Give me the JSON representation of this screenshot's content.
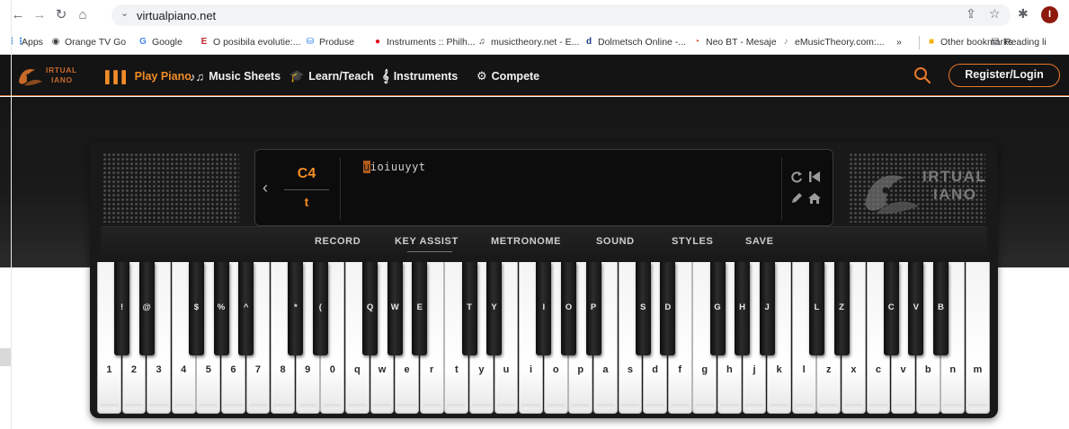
{
  "browser": {
    "url": "virtualpiano.net",
    "profile_initial": "I",
    "bookmarks": [
      {
        "label": "Apps",
        "icon": "apps-grid-icon",
        "color": "#1a73e8",
        "glyph": "⋮⋮"
      },
      {
        "label": "Orange TV Go",
        "icon": "orange-icon",
        "color": "#3c3c3c",
        "glyph": "◉"
      },
      {
        "label": "Google",
        "icon": "google-icon",
        "color": "#4285f4",
        "glyph": "G"
      },
      {
        "label": "O posibila evolutie:...",
        "icon": "e-icon",
        "color": "#c0262d",
        "glyph": "E"
      },
      {
        "label": "Produse",
        "icon": "produse-icon",
        "color": "#1a73e8",
        "glyph": "⛁"
      },
      {
        "label": "Instruments :: Philh...",
        "icon": "red-circle-icon",
        "color": "#e0001b",
        "glyph": "●"
      },
      {
        "label": "musictheory.net - E...",
        "icon": "musictheory-icon",
        "color": "#333333",
        "glyph": "♫"
      },
      {
        "label": "Dolmetsch Online -...",
        "icon": "dolmetsch-icon",
        "color": "#1b3c8a",
        "glyph": "d"
      },
      {
        "label": "Neo BT - Mesaje",
        "icon": "neo-icon",
        "color": "#e8491d",
        "glyph": "◔"
      },
      {
        "label": "eMusicTheory.com:...",
        "icon": "emusic-icon",
        "color": "#888888",
        "glyph": "♪"
      },
      {
        "label": "»",
        "icon": "more-bookmarks-icon",
        "color": "#5f6368",
        "glyph": ""
      },
      {
        "label": "Other bookmarks",
        "icon": "folder-icon",
        "color": "#f4b400",
        "glyph": "■"
      },
      {
        "label": "Reading li",
        "icon": "reading-list-icon",
        "color": "#5f6368",
        "glyph": "▤"
      }
    ]
  },
  "site": {
    "nav": [
      {
        "label": "Play Piano",
        "glyph": "▌▌▌",
        "active": true
      },
      {
        "label": "Music Sheets",
        "glyph": "♪♫",
        "active": false
      },
      {
        "label": "Learn/Teach",
        "glyph": "🎓",
        "active": false
      },
      {
        "label": "Instruments",
        "glyph": "𝄞",
        "active": false
      },
      {
        "label": "Compete",
        "glyph": "⚙",
        "active": false
      }
    ],
    "login_label": "Register/Login",
    "logo_top": "IRTUAL",
    "logo_bottom": "IANO",
    "accent": "#f28c28"
  },
  "player": {
    "note": "C4",
    "key": "t",
    "sequence_cursor": "u",
    "sequence_rest": "ioiuuyyt"
  },
  "toolbar": {
    "items": [
      "RECORD",
      "KEY ASSIST",
      "METRONOME",
      "SOUND",
      "STYLES",
      "SAVE"
    ]
  },
  "keyboard": {
    "white_keys": [
      "1",
      "2",
      "3",
      "4",
      "5",
      "6",
      "7",
      "8",
      "9",
      "0",
      "q",
      "w",
      "e",
      "r",
      "t",
      "y",
      "u",
      "i",
      "o",
      "p",
      "a",
      "s",
      "d",
      "f",
      "g",
      "h",
      "j",
      "k",
      "l",
      "z",
      "x",
      "c",
      "v",
      "b",
      "n",
      "m"
    ],
    "black_keys": [
      {
        "after": 0,
        "label": "!"
      },
      {
        "after": 1,
        "label": "@"
      },
      {
        "after": 3,
        "label": "$"
      },
      {
        "after": 4,
        "label": "%"
      },
      {
        "after": 5,
        "label": "^"
      },
      {
        "after": 7,
        "label": "*"
      },
      {
        "after": 8,
        "label": "("
      },
      {
        "after": 10,
        "label": "Q"
      },
      {
        "after": 11,
        "label": "W"
      },
      {
        "after": 12,
        "label": "E"
      },
      {
        "after": 14,
        "label": "T"
      },
      {
        "after": 15,
        "label": "Y"
      },
      {
        "after": 17,
        "label": "I"
      },
      {
        "after": 18,
        "label": "O"
      },
      {
        "after": 19,
        "label": "P"
      },
      {
        "after": 21,
        "label": "S"
      },
      {
        "after": 22,
        "label": "D"
      },
      {
        "after": 24,
        "label": "G"
      },
      {
        "after": 25,
        "label": "H"
      },
      {
        "after": 26,
        "label": "J"
      },
      {
        "after": 28,
        "label": "L"
      },
      {
        "after": 29,
        "label": "Z"
      },
      {
        "after": 31,
        "label": "C"
      },
      {
        "after": 32,
        "label": "V"
      },
      {
        "after": 33,
        "label": "B"
      }
    ]
  }
}
